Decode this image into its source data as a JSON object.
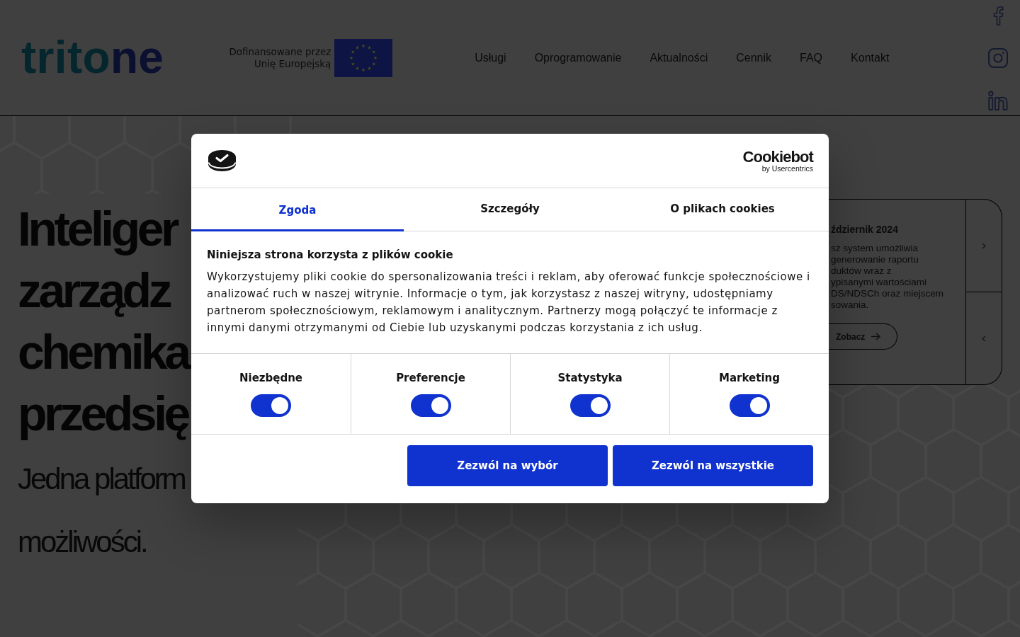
{
  "header": {
    "logo": "tritone",
    "eu_funding": "Dofinansowane przez Unię Europejską",
    "nav": [
      "Usługi",
      "Oprogramowanie",
      "Aktualności",
      "Cennik",
      "FAQ",
      "Kontakt"
    ]
  },
  "hero": {
    "heading_lines": [
      "Inteliger",
      "zarządz",
      "chemika",
      "przedsię"
    ],
    "subtitle_lines": [
      "Jedna platform",
      "możliwości."
    ]
  },
  "news_card": {
    "title": "ździernik 2024",
    "body_lines": [
      "sz system umożliwia",
      "generowanie raportu",
      "duktów wraz z",
      "ypisanymi wartościami",
      "DS/NDSCh oraz miejscem",
      "sowania."
    ],
    "button": "Zobacz"
  },
  "cookie_dialog": {
    "brand": {
      "name": "Cookiebot",
      "byline": "by Usercentrics"
    },
    "tabs": [
      {
        "label": "Zgoda",
        "selected": true
      },
      {
        "label": "Szczegóły",
        "selected": false
      },
      {
        "label": "O plikach cookies",
        "selected": false
      }
    ],
    "title": "Niniejsza strona korzysta z plików cookie",
    "text": "Wykorzystujemy pliki cookie do spersonalizowania treści i reklam, aby oferować funkcje społecznościowe i analizować ruch w naszej witrynie. Informacje o tym, jak korzystasz z naszej witryny, udostępniamy partnerom społecznościowym, reklamowym i analitycznym. Partnerzy mogą połączyć te informacje z innymi danymi otrzymanymi od Ciebie lub uzyskanymi podczas korzystania z ich usług.",
    "categories": [
      {
        "label": "Niezbędne",
        "on": true
      },
      {
        "label": "Preferencje",
        "on": true
      },
      {
        "label": "Statystyka",
        "on": true
      },
      {
        "label": "Marketing",
        "on": true
      }
    ],
    "buttons": [
      "Zezwól na wybór",
      "Zezwól na wszystkie"
    ]
  }
}
